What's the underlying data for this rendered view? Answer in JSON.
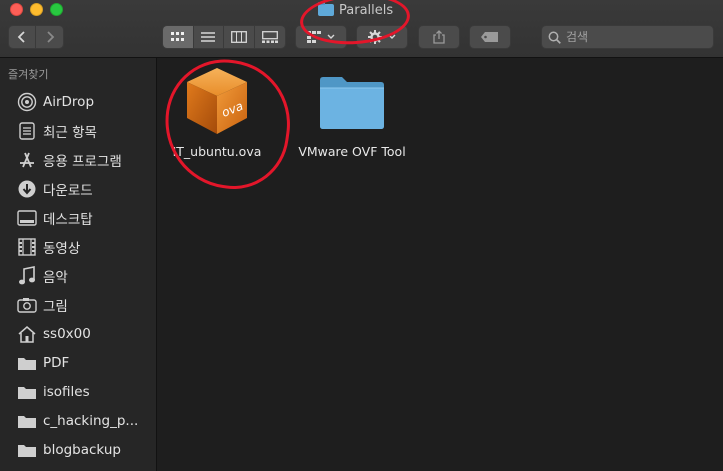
{
  "window": {
    "title": "Parallels"
  },
  "toolbar": {
    "view_modes": [
      "icon-view",
      "list-view",
      "column-view",
      "gallery-view"
    ],
    "active_view": 0,
    "search_placeholder": "검색"
  },
  "sidebar": {
    "heading": "즐겨찾기",
    "items": [
      {
        "label": "AirDrop",
        "icon": "airdrop-icon"
      },
      {
        "label": "최근 항목",
        "icon": "recents-icon"
      },
      {
        "label": "응용 프로그램",
        "icon": "applications-icon"
      },
      {
        "label": "다운로드",
        "icon": "downloads-icon"
      },
      {
        "label": "데스크탑",
        "icon": "desktop-icon"
      },
      {
        "label": "동영상",
        "icon": "movies-icon"
      },
      {
        "label": "음악",
        "icon": "music-icon"
      },
      {
        "label": "그림",
        "icon": "pictures-icon"
      },
      {
        "label": "ss0x00",
        "icon": "home-icon"
      },
      {
        "label": "PDF",
        "icon": "folder-icon"
      },
      {
        "label": "isofiles",
        "icon": "folder-icon"
      },
      {
        "label": "c_hacking_p...",
        "icon": "folder-icon"
      },
      {
        "label": "blogbackup",
        "icon": "folder-icon"
      }
    ]
  },
  "files": [
    {
      "label": "IT_ubuntu.ova",
      "icon": "ova-package-icon",
      "badge": "ova"
    },
    {
      "label": "VMware OVF Tool",
      "icon": "folder-icon"
    }
  ],
  "colors": {
    "accent_folder": "#5fa9d9",
    "annotation": "#e3162a",
    "ova_box": "#e07a1c"
  }
}
